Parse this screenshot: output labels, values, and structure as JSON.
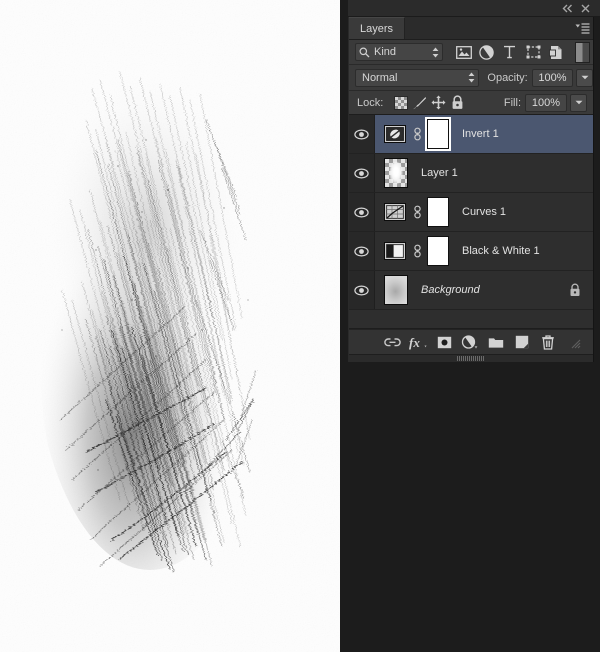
{
  "window": {
    "collapse_icon": "collapse-double-arrow-icon",
    "close_icon": "close-icon"
  },
  "panel": {
    "tab_label": "Layers",
    "menu_icon": "panel-menu-icon",
    "filter": {
      "search_icon": "search-icon",
      "kind_label": "Kind",
      "stepper_icon": "updown-stepper-icon",
      "icons": [
        {
          "name": "pixel-layer-filter-icon",
          "glyph": "image"
        },
        {
          "name": "adjustment-layer-filter-icon",
          "glyph": "circle"
        },
        {
          "name": "type-layer-filter-icon",
          "glyph": "T"
        },
        {
          "name": "shape-layer-filter-icon",
          "glyph": "square"
        },
        {
          "name": "smart-object-filter-icon",
          "glyph": "smart"
        }
      ],
      "toggle_name": "filter-enable-toggle"
    },
    "blend": {
      "mode": "Normal",
      "opacity_label": "Opacity:",
      "opacity_value": "100%",
      "fill_label": "Fill:",
      "fill_value": "100%"
    },
    "lock": {
      "label": "Lock:",
      "items": [
        {
          "name": "lock-transparent-pixels-icon"
        },
        {
          "name": "lock-image-pixels-brush-icon"
        },
        {
          "name": "lock-position-move-icon"
        },
        {
          "name": "lock-all-padlock-icon"
        }
      ]
    },
    "layers": [
      {
        "name": "Invert 1",
        "visible": true,
        "selected": true,
        "type": "adjustment",
        "adjustment_icon": "invert-adjustment-icon",
        "has_link": true,
        "has_mask": true,
        "mask_active": true,
        "locked": false,
        "italic": false
      },
      {
        "name": "Layer 1",
        "visible": true,
        "selected": false,
        "type": "pixel",
        "adjustment_icon": "",
        "has_link": false,
        "has_mask": false,
        "mask_active": false,
        "locked": false,
        "italic": false
      },
      {
        "name": "Curves 1",
        "visible": true,
        "selected": false,
        "type": "adjustment",
        "adjustment_icon": "curves-adjustment-icon",
        "has_link": true,
        "has_mask": true,
        "mask_active": false,
        "locked": false,
        "italic": false
      },
      {
        "name": "Black & White 1",
        "visible": true,
        "selected": false,
        "type": "adjustment",
        "adjustment_icon": "black-and-white-adjustment-icon",
        "has_link": true,
        "has_mask": true,
        "mask_active": false,
        "locked": false,
        "italic": false
      },
      {
        "name": "Background",
        "visible": true,
        "selected": false,
        "type": "photo",
        "adjustment_icon": "",
        "has_link": false,
        "has_mask": false,
        "mask_active": false,
        "locked": true,
        "italic": true
      }
    ],
    "toolbar": [
      {
        "name": "link-layers-button",
        "disabled": false
      },
      {
        "name": "layer-style-fx-button",
        "disabled": false
      },
      {
        "name": "add-layer-mask-button",
        "disabled": false
      },
      {
        "name": "new-adjustment-layer-button",
        "disabled": false
      },
      {
        "name": "new-group-button",
        "disabled": false
      },
      {
        "name": "new-layer-button",
        "disabled": false
      },
      {
        "name": "delete-layer-button",
        "disabled": false
      },
      {
        "name": "panel-resize-grip-icon",
        "disabled": true
      }
    ],
    "resize_grip": "horizontal-resize-grip"
  },
  "colors": {
    "panel_bg": "#343434",
    "list_bg": "#2e2e2e",
    "selected_row": "#4b5770",
    "text": "#e2e2e2",
    "field_bg": "#454545",
    "canvas_bg": "#ffffff"
  },
  "canvas": {
    "artwork_name": "pencil-hatching-sketch",
    "description": "dense graphite hatch strokes on white paper"
  }
}
